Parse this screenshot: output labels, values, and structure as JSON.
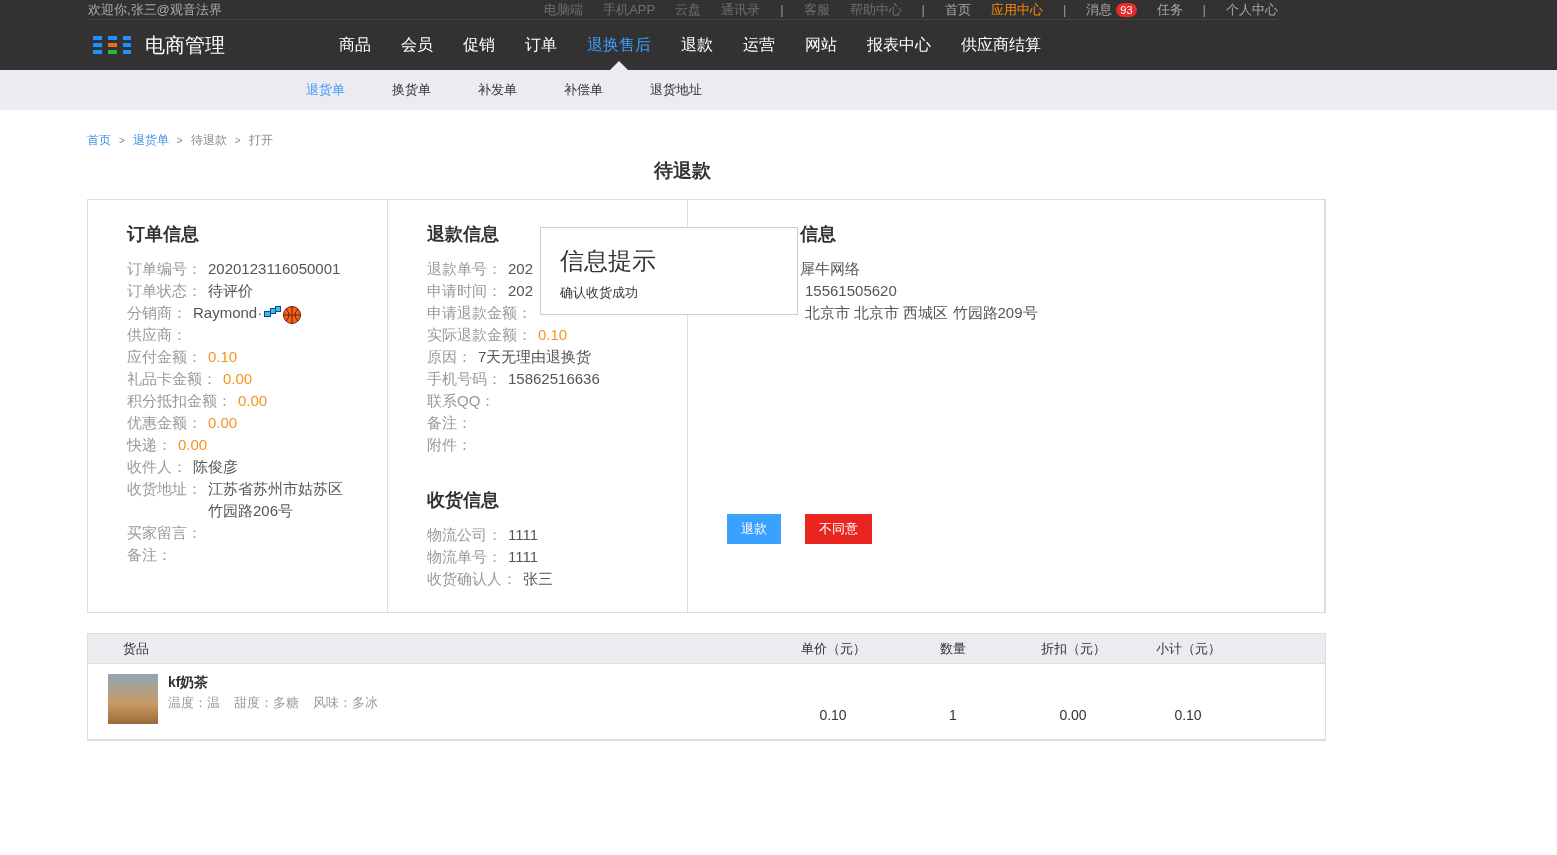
{
  "top_bar": {
    "welcome": "欢迎你,张三@观音法界",
    "groups": [
      [
        {
          "label": "电脑端",
          "kind": "muted"
        },
        {
          "label": "手机APP",
          "kind": "muted"
        },
        {
          "label": "云盘",
          "kind": "muted"
        },
        {
          "label": "通讯录",
          "kind": "muted"
        }
      ],
      [
        {
          "label": "客服",
          "kind": "muted"
        },
        {
          "label": "帮助中心",
          "kind": "muted"
        }
      ],
      [
        {
          "label": "首页",
          "kind": "normal"
        },
        {
          "label": "应用中心",
          "kind": "active"
        }
      ],
      [
        {
          "label": "消息",
          "kind": "normal",
          "badge": "93"
        },
        {
          "label": "任务",
          "kind": "normal"
        }
      ],
      [
        {
          "label": "个人中心",
          "kind": "normal"
        }
      ]
    ],
    "separator": "|"
  },
  "nav": {
    "logo": "电商管理",
    "items": [
      {
        "label": "商品",
        "selected": false
      },
      {
        "label": "会员",
        "selected": false
      },
      {
        "label": "促销",
        "selected": false
      },
      {
        "label": "订单",
        "selected": false
      },
      {
        "label": "退换售后",
        "selected": true
      },
      {
        "label": "退款",
        "selected": false
      },
      {
        "label": "运营",
        "selected": false
      },
      {
        "label": "网站",
        "selected": false
      },
      {
        "label": "报表中心",
        "selected": false
      },
      {
        "label": "供应商结算",
        "selected": false
      }
    ]
  },
  "sub_nav": {
    "items": [
      {
        "label": "退货单",
        "selected": true
      },
      {
        "label": "换货单",
        "selected": false
      },
      {
        "label": "补发单",
        "selected": false
      },
      {
        "label": "补偿单",
        "selected": false
      },
      {
        "label": "退货地址",
        "selected": false
      }
    ]
  },
  "breadcrumb": [
    {
      "label": "首页",
      "kind": "link"
    },
    {
      "label": ">",
      "kind": "sep"
    },
    {
      "label": "退货单",
      "kind": "link"
    },
    {
      "label": ">",
      "kind": "sep"
    },
    {
      "label": "待退款",
      "kind": "text"
    },
    {
      "label": ">",
      "kind": "sep"
    },
    {
      "label": "打开",
      "kind": "text"
    }
  ],
  "page_title": "待退款",
  "order_info": {
    "title": "订单信息",
    "rows": [
      {
        "label": "订单编号：",
        "value": "2020123116050001",
        "kind": "text"
      },
      {
        "label": "订单状态：",
        "value": "待评价",
        "kind": "text"
      },
      {
        "label": "分销商：",
        "value": "Raymond·",
        "kind": "user"
      },
      {
        "label": "供应商：",
        "kind": "text"
      },
      {
        "label": "应付金额：",
        "value": "0.10",
        "kind": "amount"
      },
      {
        "label": "礼品卡金额：",
        "value": "0.00",
        "kind": "amount"
      },
      {
        "label": "积分抵扣金额：",
        "value": "0.00",
        "kind": "amount"
      },
      {
        "label": "优惠金额：",
        "value": "0.00",
        "kind": "amount"
      },
      {
        "label": "快递：",
        "value": "0.00",
        "kind": "amount"
      },
      {
        "label": "收件人：",
        "value": "陈俊彦",
        "kind": "text"
      },
      {
        "label": "收货地址：",
        "value": "江苏省苏州市姑苏区竹园路206号",
        "kind": "text"
      },
      {
        "label": "买家留言：",
        "kind": "text"
      },
      {
        "label": "备注：",
        "kind": "text"
      }
    ]
  },
  "refund_info": {
    "title": "退款信息",
    "rows": [
      {
        "label": "退款单号：",
        "value": "202",
        "kind": "text"
      },
      {
        "label": "申请时间：",
        "value": "202",
        "kind": "text"
      },
      {
        "label": "申请退款金额：",
        "kind": "amount"
      },
      {
        "label": "实际退款金额：",
        "value": "0.10",
        "kind": "amount"
      },
      {
        "label": "原因：",
        "value": "7天无理由退换货",
        "kind": "text"
      },
      {
        "label": "手机号码：",
        "value": "15862516636",
        "kind": "text"
      },
      {
        "label": "联系QQ：",
        "kind": "text"
      },
      {
        "label": "备注：",
        "kind": "text"
      },
      {
        "label": "附件：",
        "kind": "text"
      }
    ]
  },
  "receipt_info": {
    "title": "收货信息",
    "rows": [
      {
        "label": "物流公司：",
        "value": "1111",
        "kind": "text"
      },
      {
        "label": "物流单号：",
        "value": "1111",
        "kind": "text"
      },
      {
        "label": "收货确认人：",
        "value": "张三",
        "kind": "text"
      }
    ]
  },
  "consignee_info": {
    "title": "信息",
    "rows": [
      {
        "value": "犀牛网络",
        "kind": "text"
      },
      {
        "value": "15561505620",
        "kind": "text"
      },
      {
        "value": "北京市 北京市 西城区 竹园路209号",
        "kind": "text"
      }
    ],
    "buttons": [
      {
        "label": "退款",
        "kind": "primary"
      },
      {
        "label": "不同意",
        "kind": "danger"
      }
    ]
  },
  "popup": {
    "title": "信息提示",
    "message": "确认收货成功"
  },
  "goods_table": {
    "columns": [
      "货品",
      "单价（元）",
      "数量",
      "折扣（元）",
      "小计（元）"
    ],
    "rows": [
      {
        "name": "kf奶茶",
        "specs": [
          "温度：温",
          "甜度：多糖",
          "风味：多冰"
        ],
        "price": "0.10",
        "quantity": "1",
        "discount": "0.00",
        "subtotal": "0.10"
      }
    ]
  }
}
